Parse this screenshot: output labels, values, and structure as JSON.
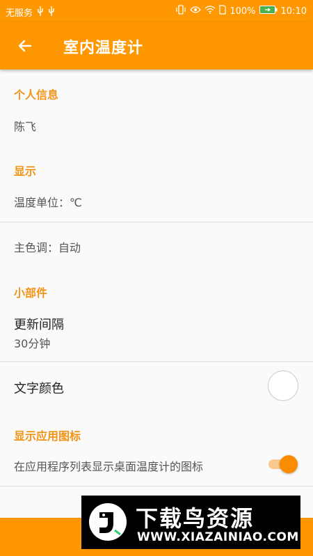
{
  "status_bar": {
    "carrier": "无服务",
    "battery": "100%",
    "time": "10:10"
  },
  "app_bar": {
    "title": "室内温度计",
    "back_icon": "arrow-left-icon"
  },
  "sections": {
    "personal": {
      "header": "个人信息",
      "name": "陈飞"
    },
    "display": {
      "header": "显示",
      "unit": "温度单位：℃",
      "theme": "主色调：自动"
    },
    "widget": {
      "header": "小部件",
      "update_title": "更新间隔",
      "update_value": "30分钟",
      "text_color_title": "文字颜色",
      "text_color_value": "#ffffff"
    },
    "app_icon": {
      "header": "显示应用图标",
      "description": "在应用程序列表显示桌面温度计的图标",
      "toggle_on": true
    }
  },
  "watermark": {
    "title": "下载鸟资源",
    "url": "WWW.XIAZAINIAO.COM"
  },
  "colors": {
    "accent": "#ff9800",
    "section_header": "#f39317"
  }
}
